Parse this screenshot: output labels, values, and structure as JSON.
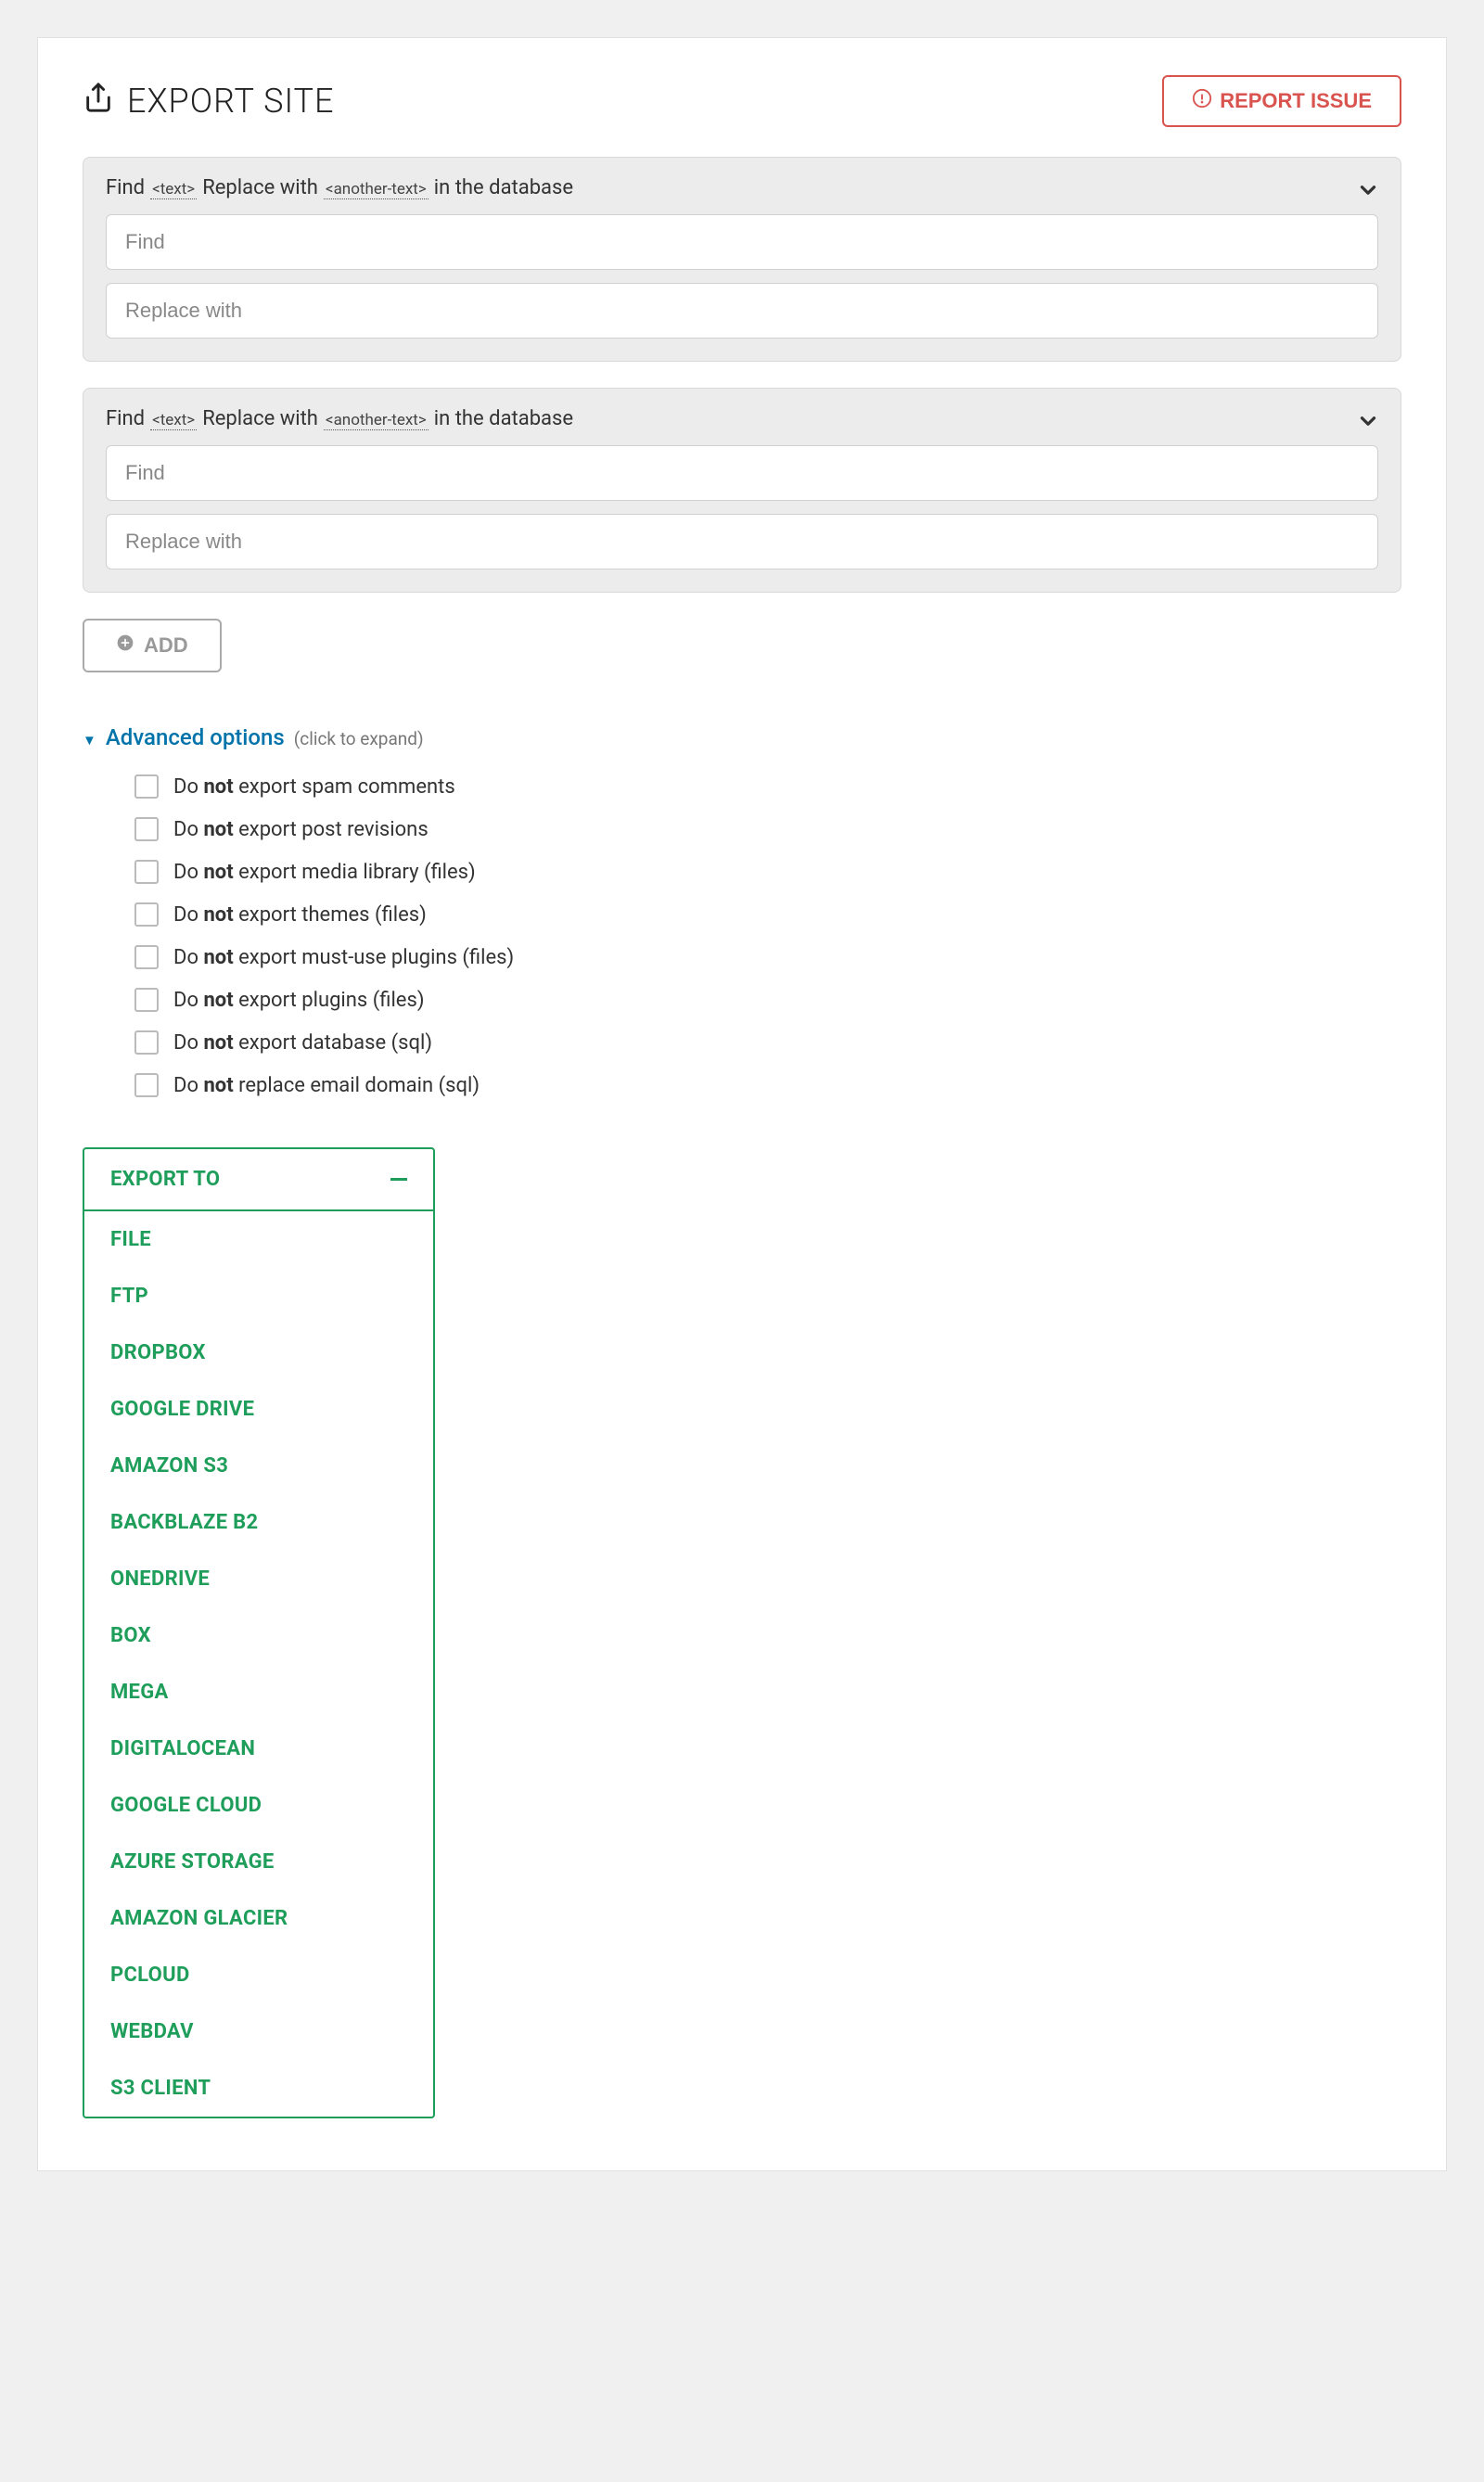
{
  "header": {
    "title": "EXPORT SITE",
    "report_issue_label": "REPORT ISSUE"
  },
  "find_replace": {
    "title_parts": {
      "find": "Find",
      "text_ph": "<text>",
      "replace_with": "Replace with",
      "another_text_ph": "<another-text>",
      "in_db": "in the database"
    },
    "find_placeholder": "Find",
    "replace_placeholder": "Replace with",
    "boxes": [
      {
        "find_value": "",
        "replace_value": ""
      },
      {
        "find_value": "",
        "replace_value": ""
      }
    ],
    "add_label": "ADD"
  },
  "advanced": {
    "label": "Advanced options",
    "hint": "(click to expand)",
    "options": [
      {
        "pre": "Do ",
        "bold": "not",
        "post": " export spam comments"
      },
      {
        "pre": "Do ",
        "bold": "not",
        "post": " export post revisions"
      },
      {
        "pre": "Do ",
        "bold": "not",
        "post": " export media library (files)"
      },
      {
        "pre": "Do ",
        "bold": "not",
        "post": " export themes (files)"
      },
      {
        "pre": "Do ",
        "bold": "not",
        "post": " export must-use plugins (files)"
      },
      {
        "pre": "Do ",
        "bold": "not",
        "post": " export plugins (files)"
      },
      {
        "pre": "Do ",
        "bold": "not",
        "post": " export database (sql)"
      },
      {
        "pre": "Do ",
        "bold": "not",
        "post": " replace email domain (sql)"
      }
    ]
  },
  "export_menu": {
    "header": "EXPORT TO",
    "items": [
      "FILE",
      "FTP",
      "DROPBOX",
      "GOOGLE DRIVE",
      "AMAZON S3",
      "BACKBLAZE B2",
      "ONEDRIVE",
      "BOX",
      "MEGA",
      "DIGITALOCEAN",
      "GOOGLE CLOUD",
      "AZURE STORAGE",
      "AMAZON GLACIER",
      "PCLOUD",
      "WEBDAV",
      "S3 CLIENT"
    ]
  }
}
